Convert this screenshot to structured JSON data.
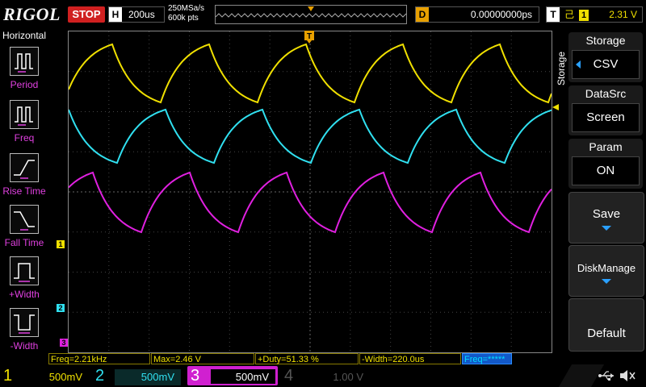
{
  "header": {
    "logo": "RIGOL",
    "run_state": "STOP",
    "timebase_label": "H",
    "timebase_value": "200us",
    "sample_rate": "250MSa/s",
    "memory_depth": "600k pts",
    "delay_label": "D",
    "delay_value": "0.00000000ps",
    "trigger_label": "T",
    "trigger_source": "1",
    "trigger_level": "2.31 V"
  },
  "left_menu": {
    "title": "Horizontal",
    "items": [
      {
        "label": "Period",
        "icon": "period-icon"
      },
      {
        "label": "Freq",
        "icon": "freq-icon"
      },
      {
        "label": "Rise Time",
        "icon": "rise-time-icon"
      },
      {
        "label": "Fall Time",
        "icon": "fall-time-icon"
      },
      {
        "label": "+Width",
        "icon": "positive-width-icon"
      },
      {
        "label": "-Width",
        "icon": "negative-width-icon"
      }
    ]
  },
  "right_menu": {
    "title": "Storage",
    "storage_value": "CSV",
    "datasrc_label": "DataSrc",
    "datasrc_value": "Screen",
    "param_label": "Param",
    "param_value": "ON",
    "save_label": "Save",
    "diskmanage_label": "DiskManage",
    "default_label": "Default"
  },
  "measurements": [
    "Freq=2.21kHz",
    "Max=2.46 V",
    "+Duty=51.33 %",
    "-Width=220.0us",
    "Freq=*****"
  ],
  "channels": [
    {
      "num": "1",
      "scale": "500mV",
      "color": "#f0e000"
    },
    {
      "num": "2",
      "scale": "500mV",
      "color": "#00e0f0"
    },
    {
      "num": "3",
      "scale": "500mV",
      "color": "#e020e0"
    },
    {
      "num": "4",
      "scale": "1.00 V",
      "color": "#555555"
    }
  ],
  "trace_markers": [
    "1",
    "2",
    "3"
  ],
  "colors": {
    "ch1": "#f0e000",
    "ch2": "#30e0f0",
    "ch3": "#e020e0",
    "stop": "#d02020"
  }
}
